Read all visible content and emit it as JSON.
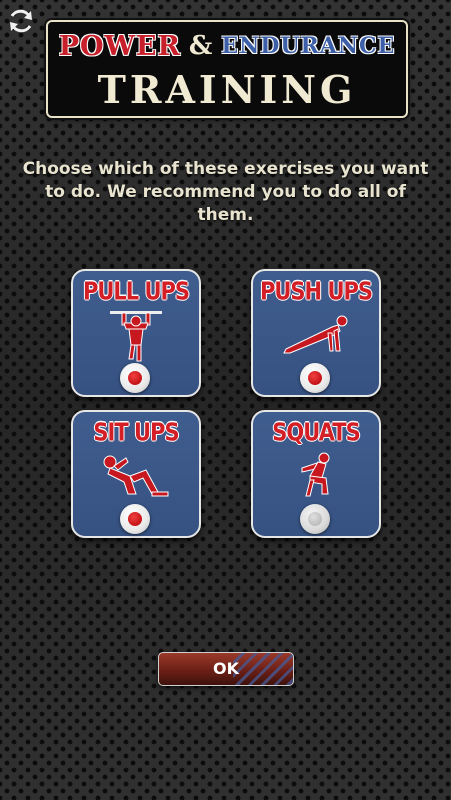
{
  "header": {
    "title_word1": "POWER",
    "title_amp": "&",
    "title_word2": "ENDURANCE",
    "title_line2": "TRAINING"
  },
  "refresh_icon": "refresh-icon",
  "instructions": "Choose which of these exercises you want to do. We recommend you to do all of them.",
  "exercises": [
    {
      "label": "PULL UPS",
      "icon": "pull-up-figure-icon",
      "selected": true
    },
    {
      "label": "PUSH UPS",
      "icon": "push-up-figure-icon",
      "selected": true
    },
    {
      "label": "SIT UPS",
      "icon": "sit-up-figure-icon",
      "selected": true
    },
    {
      "label": "SQUATS",
      "icon": "squat-figure-icon",
      "selected": false
    }
  ],
  "ok_button": {
    "label": "OK"
  },
  "colors": {
    "accent_red": "#d41e26",
    "tile_blue": "#3f5d8e",
    "title_blue": "#3c5fa8"
  }
}
